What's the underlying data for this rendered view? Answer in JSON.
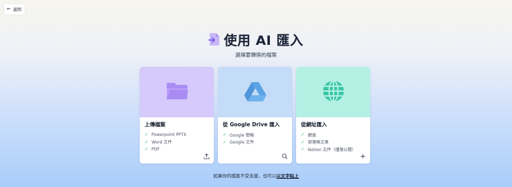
{
  "back": {
    "label": "返回",
    "icon": "arrow-left-icon"
  },
  "header": {
    "title": "使用 AI 匯入",
    "subtitle": "選擇要轉換的檔案"
  },
  "cards": [
    {
      "title": "上傳檔案",
      "bg": "#d6c9fb",
      "icon_color": "#a98cf3",
      "features": [
        "Powerpoint PPTX",
        "Word 文件",
        "PDF"
      ],
      "action_icon": "upload-icon"
    },
    {
      "title": "從 Google Drive 匯入",
      "bg": "#c4dcf7",
      "icon_color": "#5aa3e6",
      "features": [
        "Google 簡報",
        "Google 文件"
      ],
      "action_icon": "search-icon"
    },
    {
      "title": "從網址匯入",
      "bg": "#b4f0e3",
      "icon_color": "#37c6a6",
      "features": [
        "網頁",
        "部落格文章",
        "Notion 文件（僅限公開）"
      ],
      "action_icon": "plus-icon"
    }
  ],
  "footer": {
    "text": "如果你的檔案不受支援，也可以",
    "link": "以文字貼上"
  },
  "colors": {
    "check": "#3fae72",
    "title_icon": "#b39cf2"
  }
}
